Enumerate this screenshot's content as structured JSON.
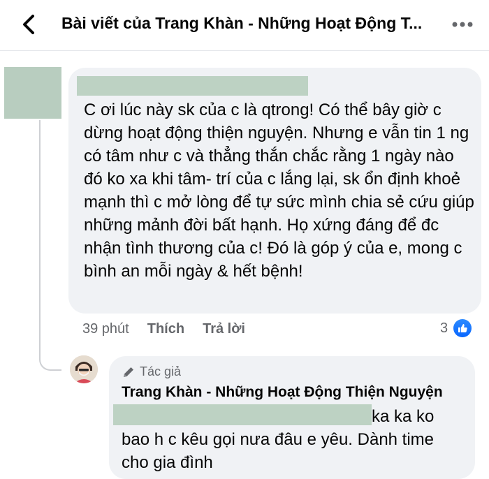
{
  "header": {
    "title": "Bài viết của Trang Khàn - Những Hoạt Động T..."
  },
  "comment": {
    "text": "C ơi lúc này sk của c là qtrong! Có thể bây giờ c dừng hoạt động thiện nguyện. Nhưng e vẫn tin 1 ng có tâm như c và thẳng thắn chắc rằng 1 ngày nào đó ko xa khi tâm- trí của c lắng lại, sk ổn định khoẻ mạnh thì c mở lòng để tự sức mình chia sẻ cứu giúp những mảnh đời bất hạnh. Họ xứng đáng để đc nhận tình thương của c! Đó là góp ý của e, mong c bình an mỗi ngày & hết bệnh!",
    "time": "39 phút",
    "like_label": "Thích",
    "reply_label": "Trả lời",
    "reaction_count": "3"
  },
  "reply": {
    "badge": "Tác giả",
    "author": "Trang Khàn - Những Hoạt Động Thiện Nguyện",
    "text": "ka ka ko bao h c kêu gọi nưa đâu e yêu. Dành time cho gia đình"
  },
  "colors": {
    "accent": "#0866ff",
    "bubble": "#f0f2f5",
    "secondary_text": "#65676b",
    "redaction": "#bdd2c3"
  },
  "icons": {
    "back": "back-arrow-icon",
    "more": "more-icon",
    "like": "like-icon",
    "badge": "pen-icon"
  }
}
